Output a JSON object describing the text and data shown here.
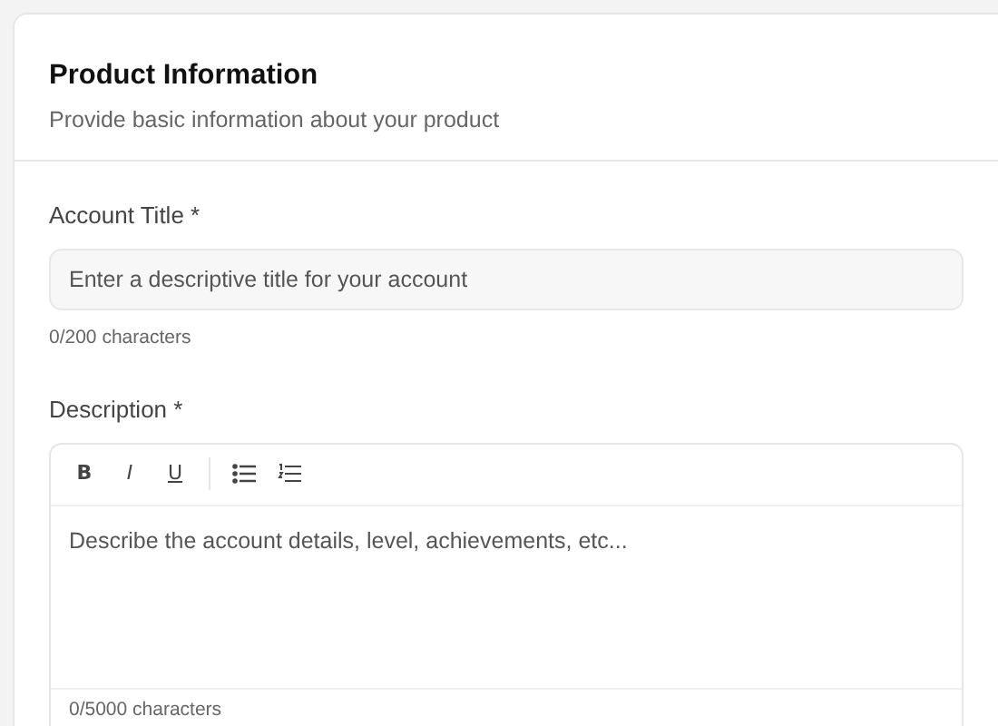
{
  "card": {
    "title": "Product Information",
    "subtitle": "Provide basic information about your product"
  },
  "fields": [
    {
      "kind": "input",
      "label": "Account Title",
      "required_mark": "*",
      "placeholder": "Enter a descriptive title for your account",
      "counter": "0/200 characters"
    },
    {
      "kind": "editor",
      "label": "Description",
      "required_mark": "*",
      "toolbar": [
        {
          "kind": "text",
          "label": "B"
        },
        {
          "kind": "text",
          "label": "I"
        },
        {
          "kind": "text",
          "label": "U"
        },
        {
          "kind": "bullet-list"
        },
        {
          "kind": "numbered-list"
        }
      ],
      "placeholder": "Describe the account details, level, achievements, etc...",
      "counter": "0/5000 characters"
    }
  ]
}
